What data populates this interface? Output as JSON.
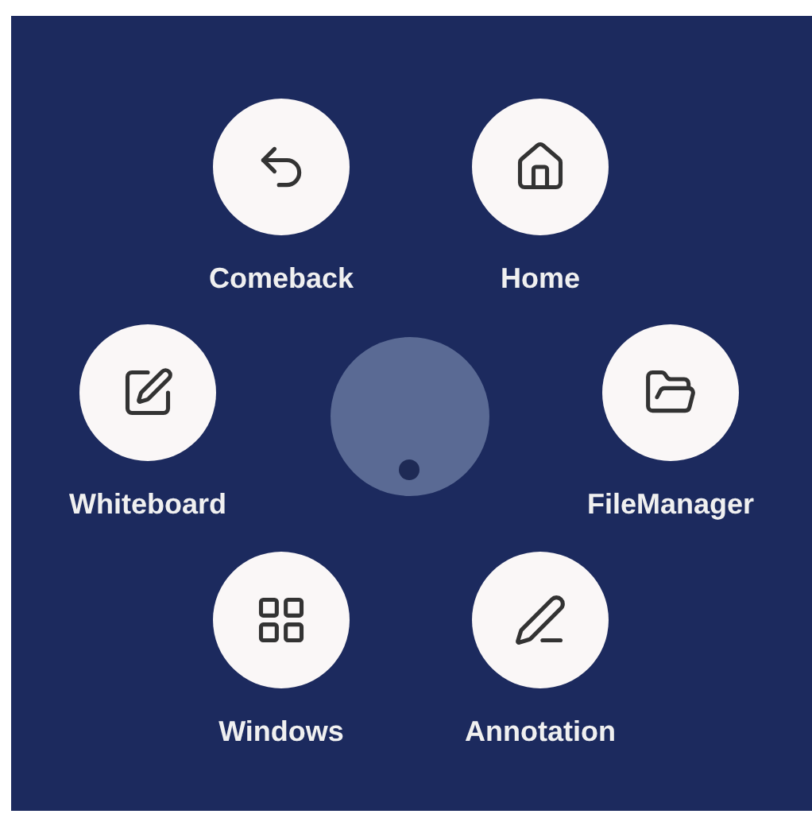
{
  "items": [
    {
      "label": "Comeback",
      "kind": "back"
    },
    {
      "label": "Home",
      "kind": "home"
    },
    {
      "label": "Whiteboard",
      "kind": "whiteboard"
    },
    {
      "label": "FileManager",
      "kind": "files"
    },
    {
      "label": "Windows",
      "kind": "windows"
    },
    {
      "label": "Annotation",
      "kind": "annotation"
    }
  ]
}
